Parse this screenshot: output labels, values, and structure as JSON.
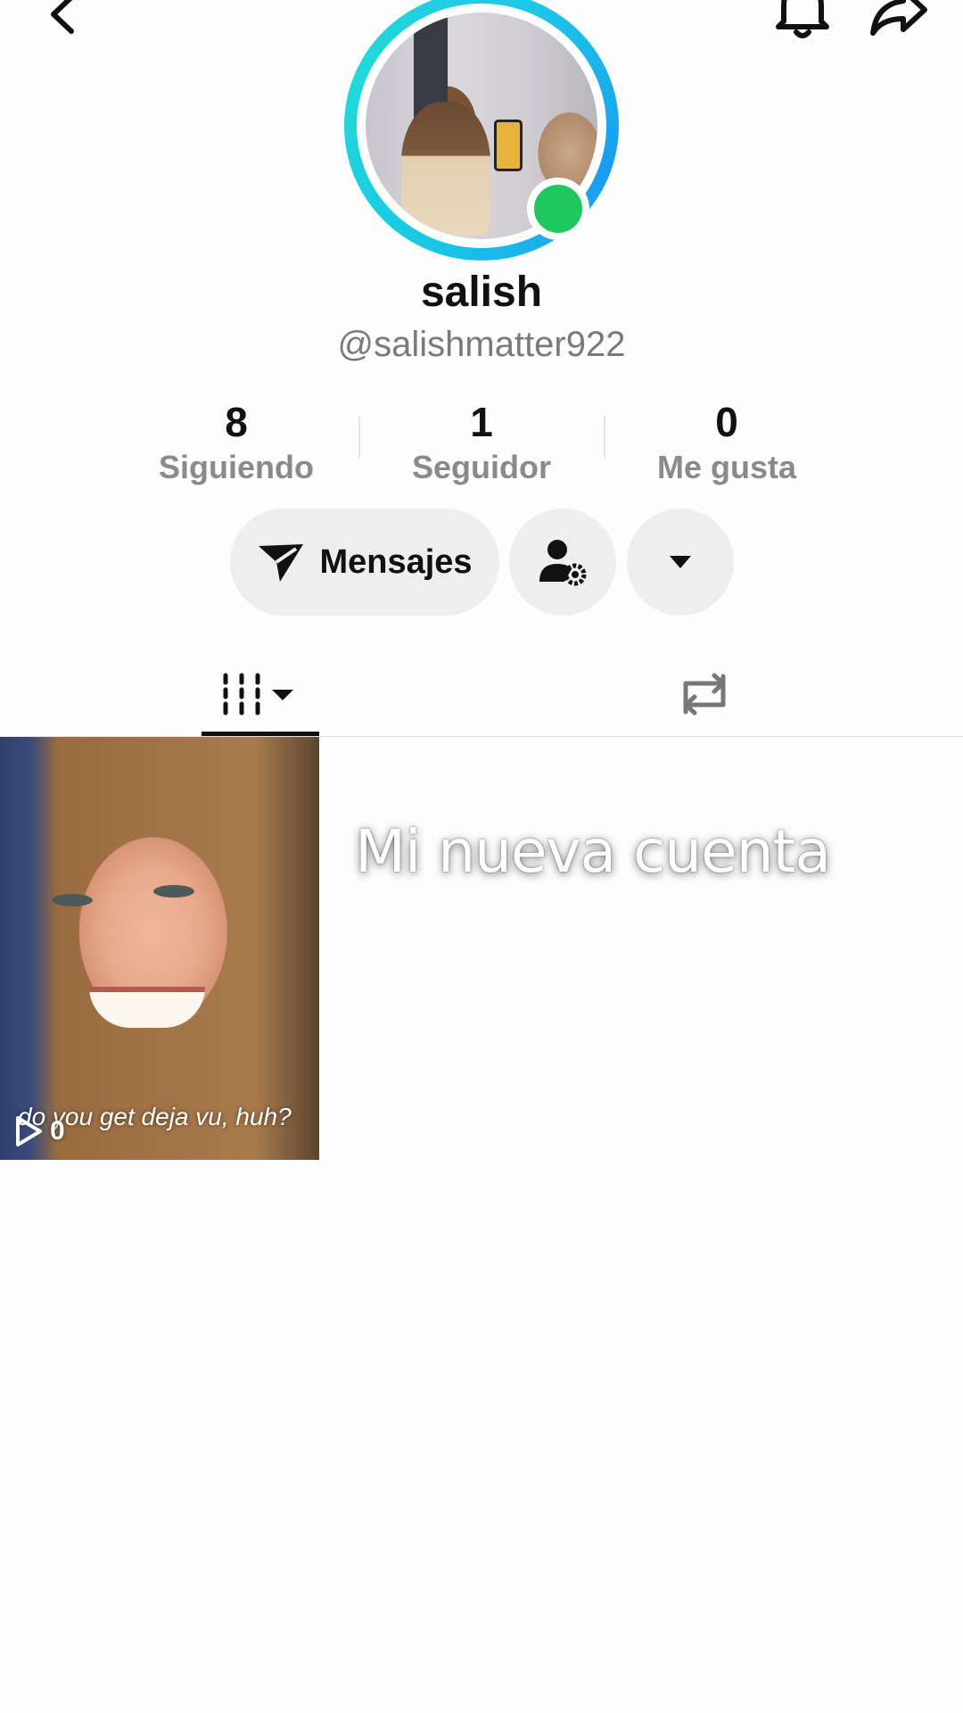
{
  "profile": {
    "display_name": "salish",
    "username": "@salishmatter922"
  },
  "stats": [
    {
      "value": "8",
      "label": "Siguiendo"
    },
    {
      "value": "1",
      "label": "Seguidor"
    },
    {
      "value": "0",
      "label": "Me gusta"
    }
  ],
  "actions": {
    "messages_label": "Mensajes"
  },
  "video": {
    "caption": "do you get deja vu, huh?",
    "views": "0"
  },
  "overlay_caption": "Mi nueva cuenta",
  "icons": {
    "back": "chevron-left-icon",
    "bell": "bell-icon",
    "share": "share-arrow-icon",
    "messages": "send-icon",
    "user_settings": "user-gear-icon",
    "more": "caret-down-icon",
    "videos_tab": "grid-icon",
    "reposts_tab": "repost-icon",
    "play": "play-icon"
  },
  "colors": {
    "online": "#20c761",
    "ring": "#19c6e6"
  }
}
